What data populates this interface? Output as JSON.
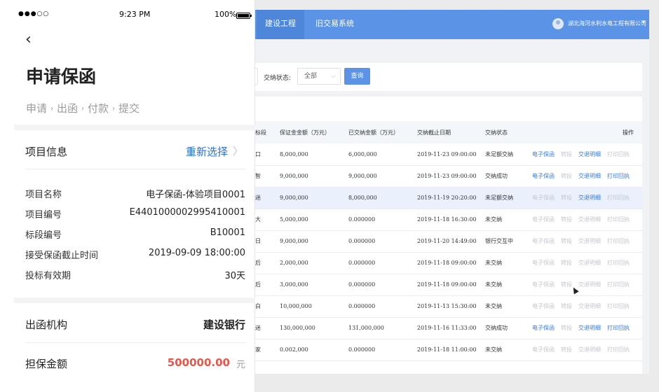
{
  "status_bar": {
    "signal": "●●●○○",
    "time": "9:23 PM",
    "battery": "100%"
  },
  "mobile": {
    "title": "申请保函",
    "steps": [
      "申请",
      "出函",
      "付款",
      "提交"
    ],
    "project_section": {
      "label": "项目信息",
      "action": "重新选择",
      "fields": [
        {
          "key": "项目名称",
          "value": "电子保函-体验项目0001"
        },
        {
          "key": "项目编号",
          "value": "E4401000002995410001"
        },
        {
          "key": "标段编号",
          "value": "B10001"
        },
        {
          "key": "接受保函截止时间",
          "value": "2019-09-09 18:00:00"
        },
        {
          "key": "投标有效期",
          "value": "30天"
        }
      ]
    },
    "issuer": {
      "label": "出函机构",
      "value": "建设银行"
    },
    "amount": {
      "label": "担保金额",
      "value": "500000.00",
      "unit": "元"
    }
  },
  "desktop": {
    "nav": {
      "tabs": [
        "建设工程",
        "旧交易系统"
      ],
      "active_tab": 0,
      "company": "湖北海河水利水电工程有限公司"
    },
    "filter": {
      "label": "交纳状态:",
      "select_value": "全部",
      "query_button": "查询"
    },
    "table": {
      "headers": [
        "标段",
        "保证金金额（万元）",
        "已交纳金额（万元）",
        "交纳截止日期",
        "交纳状态",
        "操作"
      ],
      "actions": [
        "电子保函",
        "转投",
        "交退明细",
        "打印回执"
      ],
      "rows": [
        {
          "seg": "口",
          "amount": "8,000,000",
          "paid": "6,000,000",
          "deadline": "2019-11-23 09:00:00",
          "status": "未足额交纳",
          "enabled": [
            true,
            false,
            true,
            false
          ]
        },
        {
          "seg": "智",
          "amount": "9,000,000",
          "paid": "9,000,000",
          "deadline": "2019-11-23 09:00:00",
          "status": "交纳成功",
          "enabled": [
            true,
            false,
            true,
            true
          ]
        },
        {
          "seg": "迷",
          "amount": "9,000,000",
          "paid": "8,000,000",
          "deadline": "2019-11-19 20:20:00",
          "status": "未足额交纳",
          "enabled": [
            false,
            false,
            true,
            false
          ]
        },
        {
          "seg": "大",
          "amount": "5,000,000",
          "paid": "0.000000",
          "deadline": "2019-11-18 16:30:00",
          "status": "未交纳",
          "enabled": [
            false,
            false,
            false,
            false
          ]
        },
        {
          "seg": "日",
          "amount": "9,000,000",
          "paid": "0.000000",
          "deadline": "2019-11-20 14:49:00",
          "status": "银行交互中",
          "enabled": [
            false,
            false,
            false,
            false
          ]
        },
        {
          "seg": "后",
          "amount": "2,000,000",
          "paid": "0.000000",
          "deadline": "2019-11-18 09:00:00",
          "status": "未交纳",
          "enabled": [
            false,
            false,
            false,
            false
          ]
        },
        {
          "seg": "后",
          "amount": "3,000,000",
          "paid": "0.000000",
          "deadline": "2019-11-18 09:00:00",
          "status": "未交纳",
          "enabled": [
            false,
            false,
            false,
            false
          ]
        },
        {
          "seg": "白",
          "amount": "10,000,000",
          "paid": "0.000000",
          "deadline": "2019-11-13 15:30:00",
          "status": "未交纳",
          "enabled": [
            false,
            false,
            false,
            false
          ]
        },
        {
          "seg": "迷",
          "amount": "130,000,000",
          "paid": "131,000,000",
          "deadline": "2019-11-16 11:33:00",
          "status": "交纳成功",
          "enabled": [
            true,
            false,
            true,
            true
          ]
        },
        {
          "seg": "家",
          "amount": "0.002,000",
          "paid": "0.000000",
          "deadline": "2019-11-18 11:00:00",
          "status": "未交纳",
          "enabled": [
            false,
            false,
            false,
            false
          ]
        }
      ]
    }
  }
}
